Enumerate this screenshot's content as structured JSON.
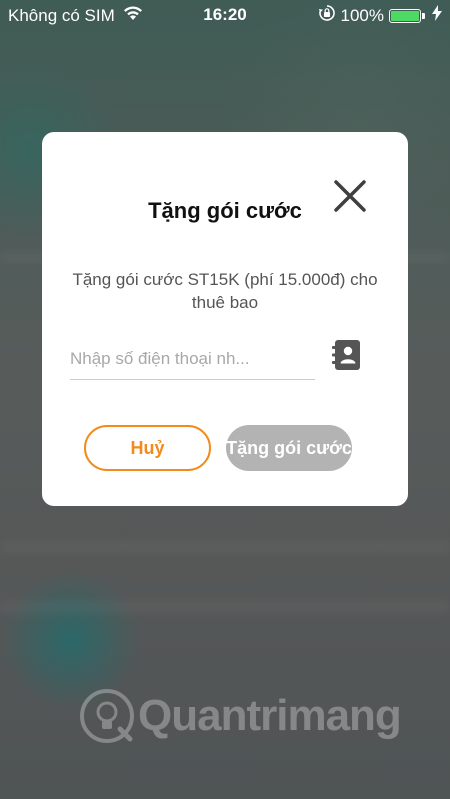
{
  "status_bar": {
    "carrier": "Không có SIM",
    "time": "16:20",
    "battery_percent": "100%",
    "battery_level": 1.0,
    "icons": [
      "wifi-icon",
      "orientation-lock-icon",
      "battery-icon",
      "charging-bolt-icon"
    ]
  },
  "dialog": {
    "title": "Tặng gói cước",
    "message": "Tặng gói cước ST15K (phí 15.000đ) cho thuê bao",
    "phone_input": {
      "placeholder": "Nhập số điện thoại nh...",
      "value": ""
    },
    "cancel_label": "Huỷ",
    "confirm_label": "Tặng gói cước",
    "icons": [
      "close-icon",
      "contact-book-icon"
    ]
  },
  "watermark": {
    "brand": "Quantrimang"
  },
  "colors": {
    "accent_orange": "#f28b1c",
    "disabled_gray": "#b3b3b3",
    "battery_green": "#4cd964"
  }
}
